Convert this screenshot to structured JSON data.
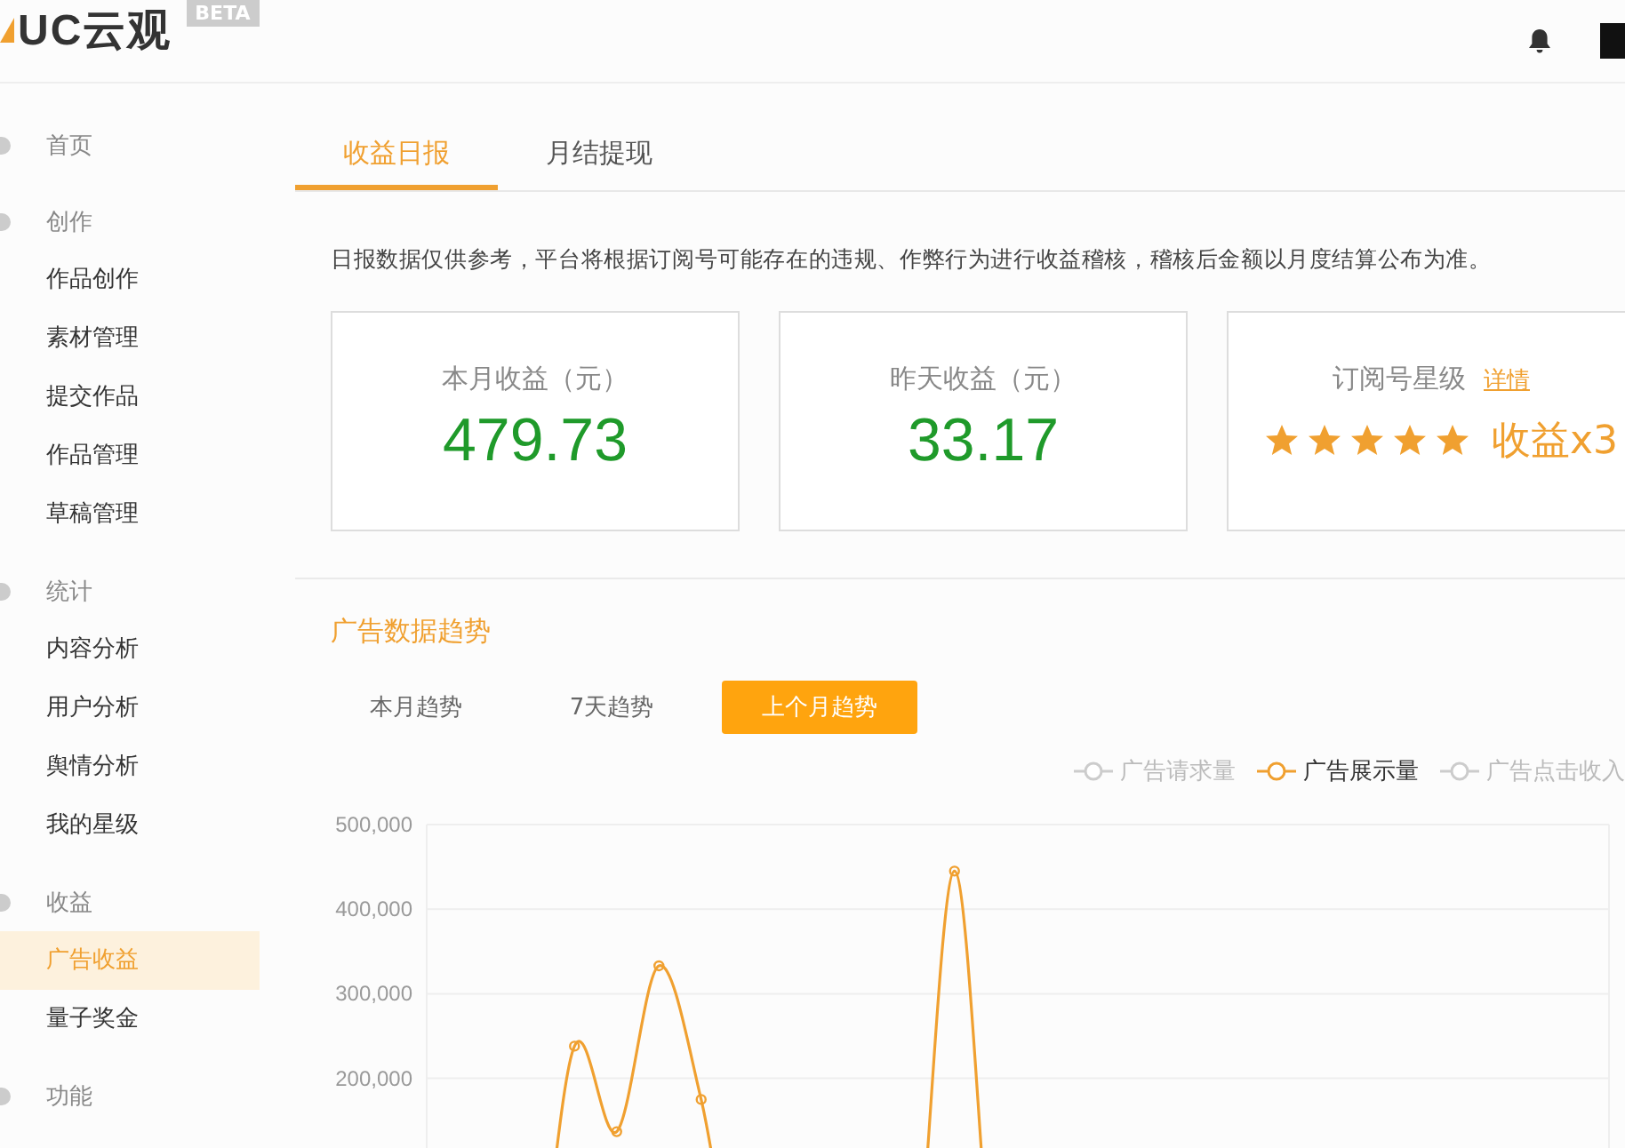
{
  "header": {
    "logo": "UC云观",
    "badge": "BETA"
  },
  "sidebar": {
    "groups": [
      {
        "title": "首页"
      },
      {
        "title": "创作",
        "items": [
          {
            "label": "作品创作",
            "selected": false
          },
          {
            "label": "素材管理",
            "selected": false
          },
          {
            "label": "提交作品",
            "selected": false
          },
          {
            "label": "作品管理",
            "selected": false
          },
          {
            "label": "草稿管理",
            "selected": false
          }
        ]
      },
      {
        "title": "统计",
        "items": [
          {
            "label": "内容分析",
            "selected": false
          },
          {
            "label": "用户分析",
            "selected": false
          },
          {
            "label": "舆情分析",
            "selected": false
          },
          {
            "label": "我的星级",
            "selected": false
          }
        ]
      },
      {
        "title": "收益",
        "items": [
          {
            "label": "广告收益",
            "selected": true
          },
          {
            "label": "量子奖金",
            "selected": false
          }
        ]
      },
      {
        "title": "功能"
      }
    ]
  },
  "tabs": [
    {
      "label": "收益日报",
      "selected": true
    },
    {
      "label": "月结提现",
      "selected": false
    }
  ],
  "notice": "日报数据仅供参考，平台将根据订阅号可能存在的违规、作弊行为进行收益稽核，稽核后金额以月度结算公布为准。",
  "stats": [
    {
      "kind": "amount",
      "label": "本月收益（元）",
      "value": "479.73"
    },
    {
      "kind": "amount",
      "label": "昨天收益（元）",
      "value": "33.17"
    },
    {
      "kind": "rating",
      "label": "订阅号星级",
      "link": "详情",
      "stars": 5,
      "value": "收益x3"
    }
  ],
  "trend": {
    "title": "广告数据趋势",
    "periods": [
      {
        "label": "本月趋势",
        "selected": false
      },
      {
        "label": "7天趋势",
        "selected": false
      },
      {
        "label": "上个月趋势",
        "selected": true
      }
    ],
    "legend": [
      {
        "kind": "label",
        "label": "广告请求量",
        "selected": false
      },
      {
        "kind": "series",
        "selected": true
      },
      {
        "kind": "label",
        "label": "广告点击收入",
        "selected": false
      }
    ],
    "chart_data": {
      "type": "line",
      "grid": true,
      "ylim": [
        0,
        500000
      ],
      "yticks": [
        {
          "value": 200000,
          "label": "200,000"
        },
        {
          "value": 300000,
          "label": "300,000"
        },
        {
          "value": 400000,
          "label": "400,000"
        },
        {
          "value": 500000,
          "label": "500,000"
        }
      ],
      "series": [
        {
          "name": "广告展示量",
          "color": "#f0a030",
          "marker": "circle",
          "values": [
            null,
            null,
            null,
            238000,
            137000,
            333000,
            175000,
            null,
            null,
            null,
            null,
            null,
            445000,
            null,
            null,
            null,
            null,
            null,
            null,
            null,
            null,
            null,
            null,
            null,
            null,
            null,
            null,
            null
          ]
        }
      ]
    }
  }
}
